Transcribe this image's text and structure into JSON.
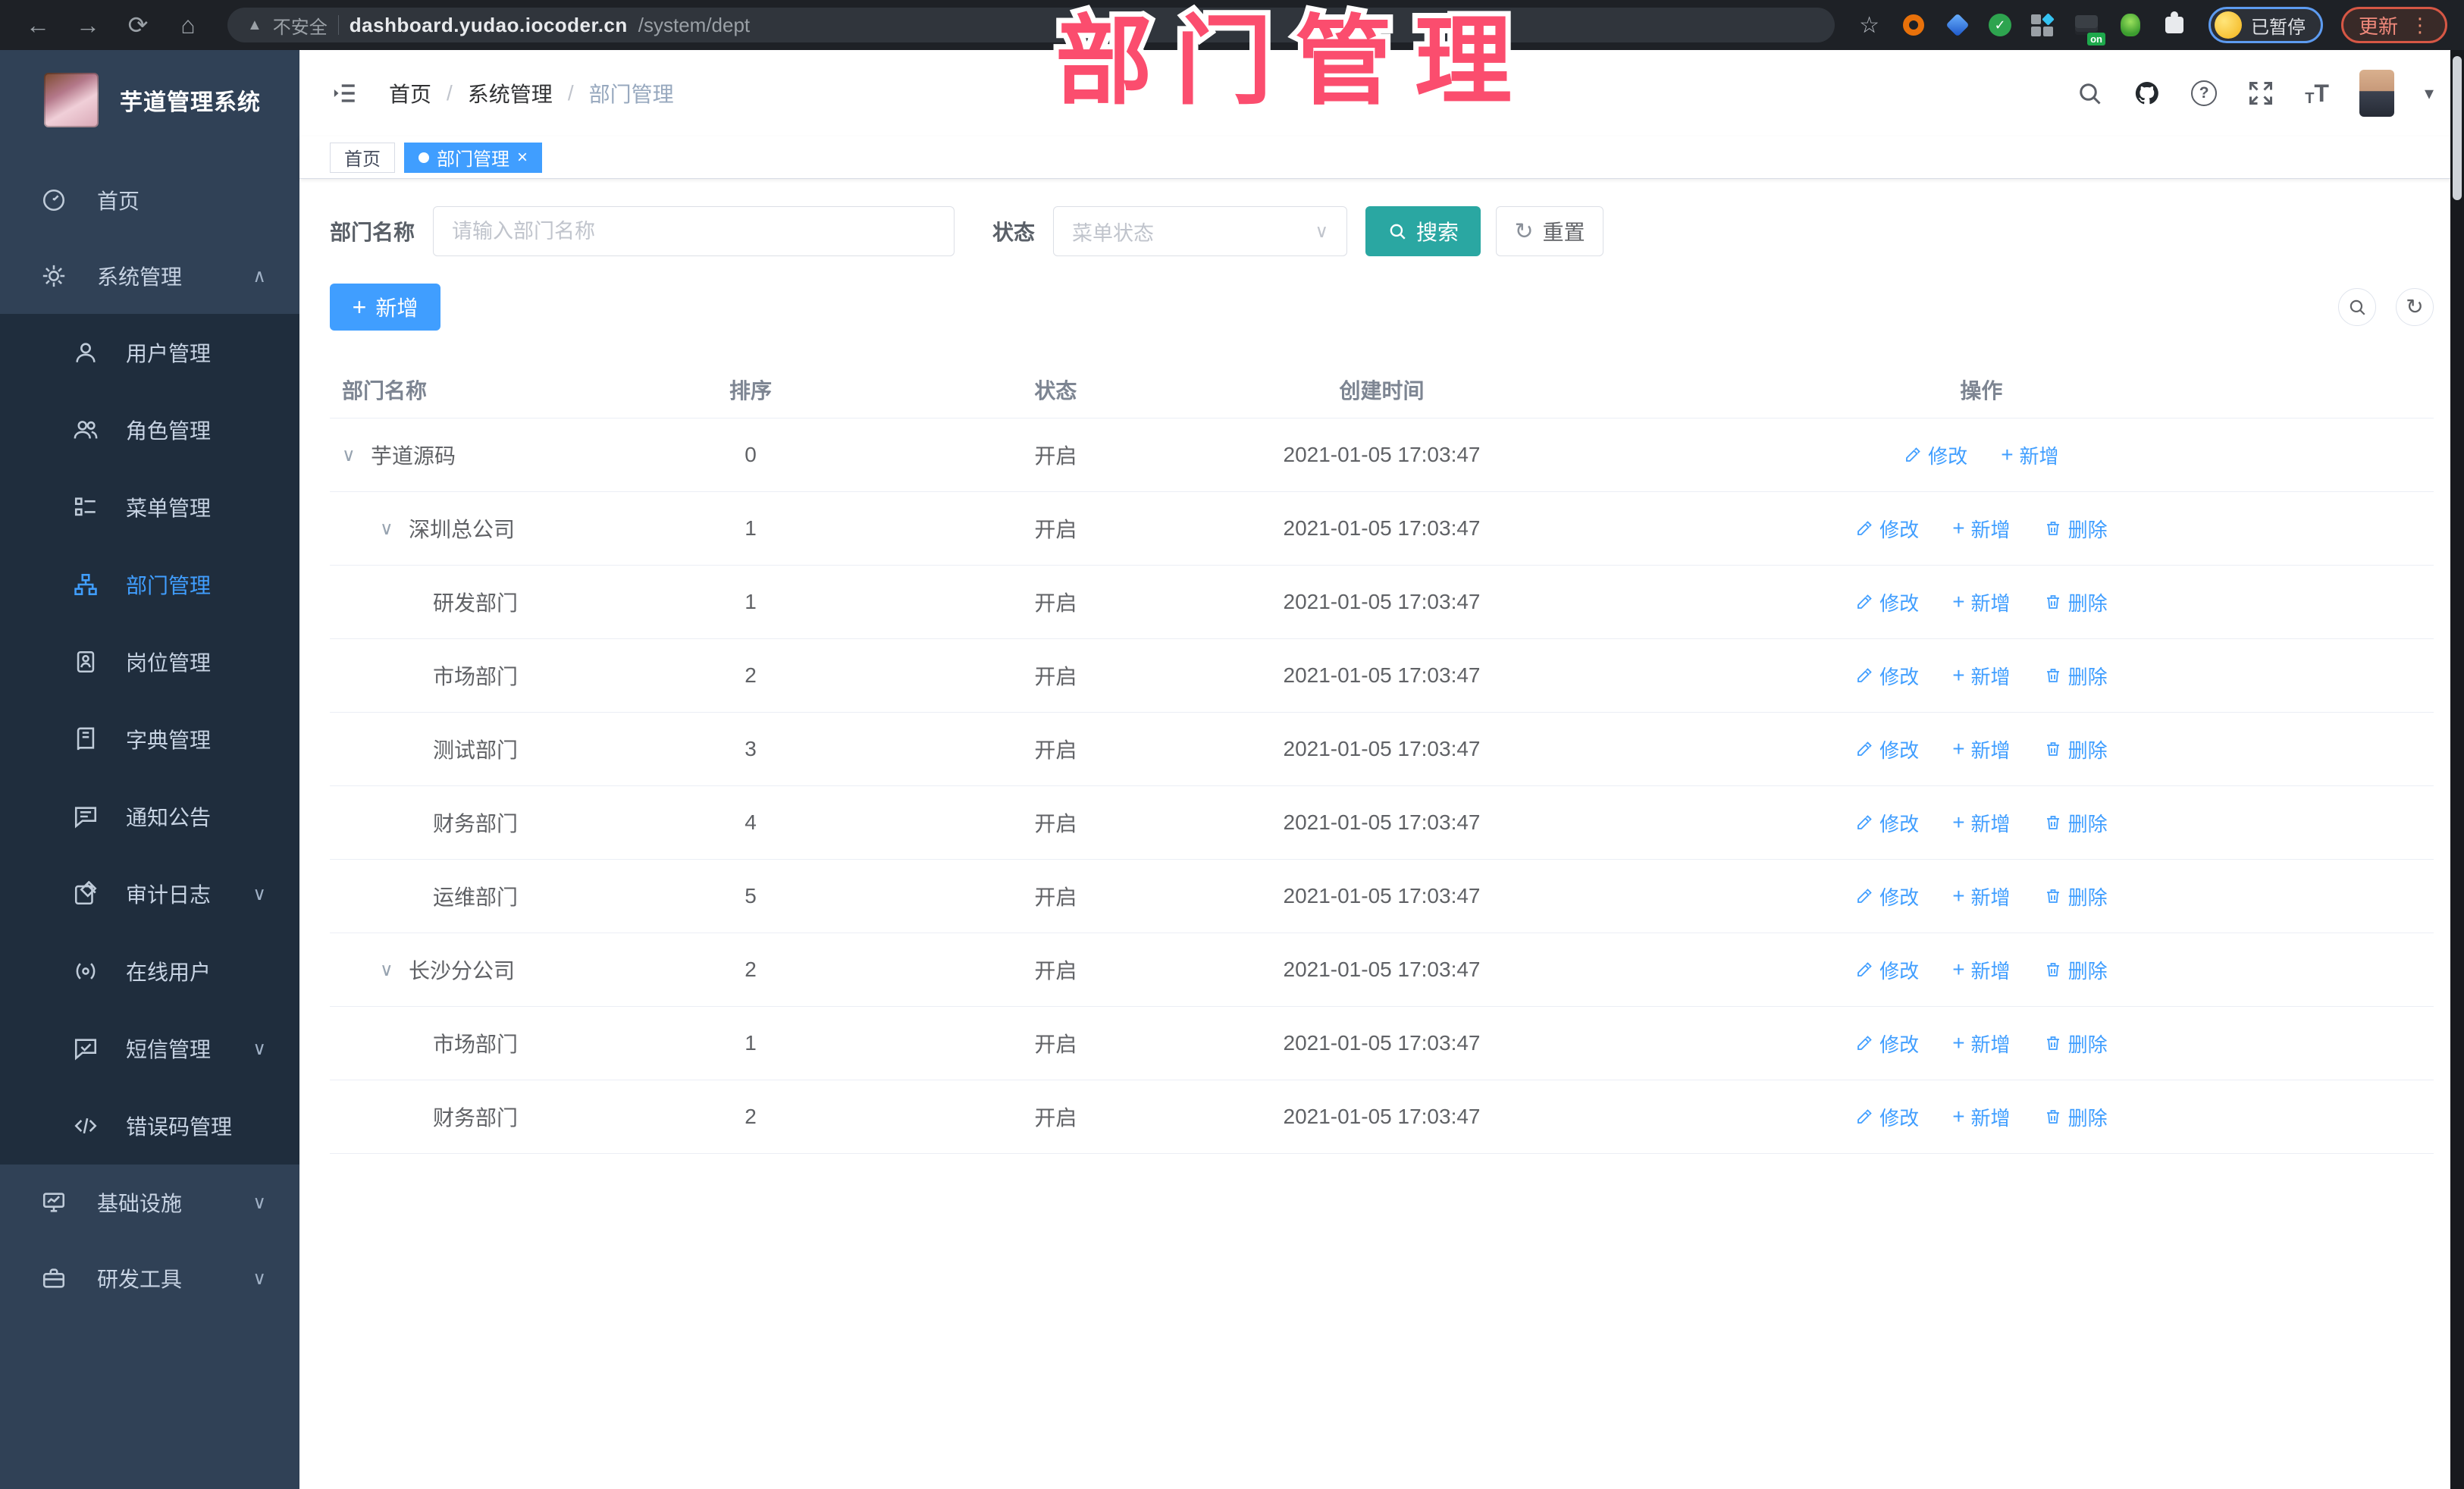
{
  "watermark": {
    "title": "部门管理"
  },
  "browser": {
    "security_label": "不安全",
    "url_domain": "dashboard.yudao.iocoder.cn",
    "url_path": "/system/dept",
    "profile_status": "已暂停",
    "update_label": "更新",
    "extension_badge": "on"
  },
  "icons": {
    "back": "←",
    "forward": "→",
    "reload": "⟳",
    "home": "⌂",
    "warning": "▲",
    "star": "☆",
    "more_vertical": "⋮",
    "check": "✓",
    "caret_up": "∧",
    "caret_down": "∨",
    "expand_arrow": "∨",
    "select_caret": "∨",
    "close": "×",
    "refresh": "↻",
    "plus": "+",
    "help": "?",
    "header_caret": "▾",
    "font_t": "T"
  },
  "sidebar": {
    "logo_title": "芋道管理系统",
    "items": [
      {
        "id": "home",
        "label": "首页",
        "icon": "dashboard-icon",
        "type": "root",
        "caret": "",
        "active": false
      },
      {
        "id": "system-management",
        "label": "系统管理",
        "icon": "gear-icon",
        "type": "root",
        "caret": "up",
        "active": false
      },
      {
        "id": "user-management",
        "label": "用户管理",
        "icon": "user-icon",
        "type": "sub",
        "caret": "",
        "active": false
      },
      {
        "id": "role-management",
        "label": "角色管理",
        "icon": "users-icon",
        "type": "sub",
        "caret": "",
        "active": false
      },
      {
        "id": "menu-management",
        "label": "菜单管理",
        "icon": "menu-icon",
        "type": "sub",
        "caret": "",
        "active": false
      },
      {
        "id": "dept-management",
        "label": "部门管理",
        "icon": "dept-icon",
        "type": "sub",
        "caret": "",
        "active": true
      },
      {
        "id": "post-management",
        "label": "岗位管理",
        "icon": "post-icon",
        "type": "sub",
        "caret": "",
        "active": false
      },
      {
        "id": "dict-management",
        "label": "字典管理",
        "icon": "dict-icon",
        "type": "sub",
        "caret": "",
        "active": false
      },
      {
        "id": "notice-announcement",
        "label": "通知公告",
        "icon": "notice-icon",
        "type": "sub",
        "caret": "",
        "active": false
      },
      {
        "id": "audit-log",
        "label": "审计日志",
        "icon": "log-icon",
        "type": "sub",
        "caret": "down",
        "active": false
      },
      {
        "id": "online-users",
        "label": "在线用户",
        "icon": "online-icon",
        "type": "sub",
        "caret": "",
        "active": false
      },
      {
        "id": "sms-management",
        "label": "短信管理",
        "icon": "sms-icon",
        "type": "sub",
        "caret": "down",
        "active": false
      },
      {
        "id": "error-code-management",
        "label": "错误码管理",
        "icon": "code-icon",
        "type": "sub",
        "caret": "",
        "active": false
      },
      {
        "id": "infrastructure",
        "label": "基础设施",
        "icon": "infra-icon",
        "type": "root",
        "caret": "down",
        "active": false
      },
      {
        "id": "dev-tools",
        "label": "研发工具",
        "icon": "tools-icon",
        "type": "root",
        "caret": "down",
        "active": false
      }
    ]
  },
  "header": {
    "breadcrumb": [
      "首页",
      "系统管理",
      "部门管理"
    ]
  },
  "tabs": [
    {
      "label": "首页",
      "active": false
    },
    {
      "label": "部门管理",
      "active": true
    }
  ],
  "filters": {
    "name_label": "部门名称",
    "name_placeholder": "请输入部门名称",
    "status_label": "状态",
    "status_placeholder": "菜单状态",
    "search_label": "搜索",
    "reset_label": "重置"
  },
  "toolbar": {
    "add_label": "新增"
  },
  "table": {
    "columns": [
      "部门名称",
      "排序",
      "状态",
      "创建时间",
      "操作"
    ],
    "action_labels": {
      "modify": "修改",
      "add": "新增",
      "delete": "删除"
    },
    "rows": [
      {
        "level": 0,
        "expandable": true,
        "name": "芋道源码",
        "sort": "0",
        "status": "开启",
        "date": "2021-01-05 17:03:47",
        "actions": [
          "modify",
          "add"
        ]
      },
      {
        "level": 1,
        "expandable": true,
        "name": "深圳总公司",
        "sort": "1",
        "status": "开启",
        "date": "2021-01-05 17:03:47",
        "actions": [
          "modify",
          "add",
          "delete"
        ]
      },
      {
        "level": 2,
        "expandable": false,
        "name": "研发部门",
        "sort": "1",
        "status": "开启",
        "date": "2021-01-05 17:03:47",
        "actions": [
          "modify",
          "add",
          "delete"
        ]
      },
      {
        "level": 2,
        "expandable": false,
        "name": "市场部门",
        "sort": "2",
        "status": "开启",
        "date": "2021-01-05 17:03:47",
        "actions": [
          "modify",
          "add",
          "delete"
        ]
      },
      {
        "level": 2,
        "expandable": false,
        "name": "测试部门",
        "sort": "3",
        "status": "开启",
        "date": "2021-01-05 17:03:47",
        "actions": [
          "modify",
          "add",
          "delete"
        ]
      },
      {
        "level": 2,
        "expandable": false,
        "name": "财务部门",
        "sort": "4",
        "status": "开启",
        "date": "2021-01-05 17:03:47",
        "actions": [
          "modify",
          "add",
          "delete"
        ]
      },
      {
        "level": 2,
        "expandable": false,
        "name": "运维部门",
        "sort": "5",
        "status": "开启",
        "date": "2021-01-05 17:03:47",
        "actions": [
          "modify",
          "add",
          "delete"
        ]
      },
      {
        "level": 1,
        "expandable": true,
        "name": "长沙分公司",
        "sort": "2",
        "status": "开启",
        "date": "2021-01-05 17:03:47",
        "actions": [
          "modify",
          "add",
          "delete"
        ]
      },
      {
        "level": 2,
        "expandable": false,
        "name": "市场部门",
        "sort": "1",
        "status": "开启",
        "date": "2021-01-05 17:03:47",
        "actions": [
          "modify",
          "add",
          "delete"
        ]
      },
      {
        "level": 2,
        "expandable": false,
        "name": "财务部门",
        "sort": "2",
        "status": "开启",
        "date": "2021-01-05 17:03:47",
        "actions": [
          "modify",
          "add",
          "delete"
        ]
      }
    ]
  },
  "colors": {
    "accent": "#409eff",
    "search_teal": "#2aa7a2",
    "watermark_pink": "#fb4d6e",
    "sidebar_bg": "#304156",
    "submenu_bg": "#1f2d3d",
    "browser_bar": "#1e2126"
  }
}
